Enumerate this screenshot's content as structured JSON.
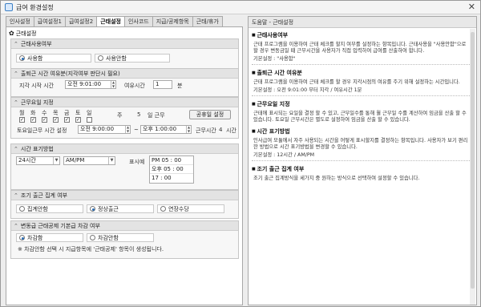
{
  "window": {
    "title": "급여 환경설정",
    "close_glyph": "✕",
    "app_icon": "window-app-icon"
  },
  "tabs": [
    {
      "label": "인사설정"
    },
    {
      "label": "급여설정1"
    },
    {
      "label": "급여설정2"
    },
    {
      "label": "근태설정",
      "active": true
    },
    {
      "label": "인사코드"
    },
    {
      "label": "지급/공제항목"
    },
    {
      "label": "근태/휴가"
    }
  ],
  "panel": {
    "header": "근태설정",
    "usage": {
      "title": "근태사용여부",
      "use": "사용함",
      "nouse": "사용안함",
      "selected": "사용함"
    },
    "clock": {
      "title": "출퇴근 시간 여유분(지각여부 판단시 필요)",
      "start_label": "지각 시작 시간",
      "start_value": "오전 9:01:00",
      "spare_label": "여유시간",
      "spare_value": "1",
      "spare_unit": "분"
    },
    "workdays": {
      "title": "근무요일 지정",
      "days": [
        "월",
        "화",
        "수",
        "목",
        "금",
        "토",
        "일"
      ],
      "checked": [
        true,
        true,
        true,
        true,
        true,
        true,
        false
      ],
      "weekly_prefix": "주",
      "weekly_count": "5",
      "weekly_suffix": "일 근무",
      "holiday_button": "공휴일 설정",
      "sat_label": "토요일근무 시간 설정",
      "sat_from": "오전 9:00:00",
      "tilde": "~",
      "sat_to": "오후 1:00:00",
      "work_hours_label": "근무시간",
      "work_hours": "4",
      "work_hours_unit": "시간"
    },
    "timefmt": {
      "title": "시간 표기방법",
      "combo1": "24시간",
      "combo2": "AM/PM",
      "display_label": "표시예",
      "examples": [
        "PM 05 : 00",
        "오후 05 : 00",
        "17 : 00"
      ]
    },
    "early": {
      "title": "조기 출근 집계 여부",
      "options": [
        "집계안함",
        "정상출근",
        "연장수당"
      ],
      "selected": "정상출근"
    },
    "deduct": {
      "title": "변동급 근태공제 기본급 차감 여부",
      "options": [
        "차감함",
        "차감안함"
      ],
      "selected": "차감함",
      "note": "※ 차감안함 선택 시 지급항목에 '근태공제' 항목이 생성됩니다."
    }
  },
  "help": {
    "title": "도움말 - 근태설정",
    "sections": [
      {
        "heading": "근태사용여부",
        "body": "근태 프로그램을 이용하여 근태 체크를 할지 여부를 설정하는 항목입니다. 근태사용을 \"사용안함\"으로 할 경우 변동금일 때 근무시간을 사용자가 직접 입력하여 급여를 산출하여 합니다.",
        "meta": "기본설정 : \"사용함\""
      },
      {
        "heading": "출퇴근 시간 여유분",
        "body": "근태 프로그램을 이용하여 근태 체크를 할 경우 지각시점의 여유를 주기 위해 설정하는 시간입니다.",
        "meta": "기본설정 : 오전 9:01:00 부터 지각 / 여유시간 1분"
      },
      {
        "heading": "근무요일 지정",
        "body": "근태에 표시되는 요일을 결정 할 수 있고, 근무일수를 통해 월 근무일 수를 계산하여 임금을 산출 할 수 있습니다. 토요일 근무시간은 별도로 설정하여 임금을 산출 할 수 있습니다.",
        "meta": ""
      },
      {
        "heading": "시간 표기방법",
        "body": "인사급여 모듈에서 자주 사용되는 시간을 어떻게 표시할지를 결정하는 항목입니다. 사용자가 보기 편리한 방법으로 시간 표기방법을 변경할 수 있습니다.",
        "meta": "기본설정 : 12시간 / AM/PM"
      },
      {
        "heading": "조기 출근 집계 여부",
        "body": "조기 출근 집계방식을 세가지 중 원하는 방식으로 선택하여 설정할 수 있습니다.",
        "meta": ""
      }
    ]
  }
}
